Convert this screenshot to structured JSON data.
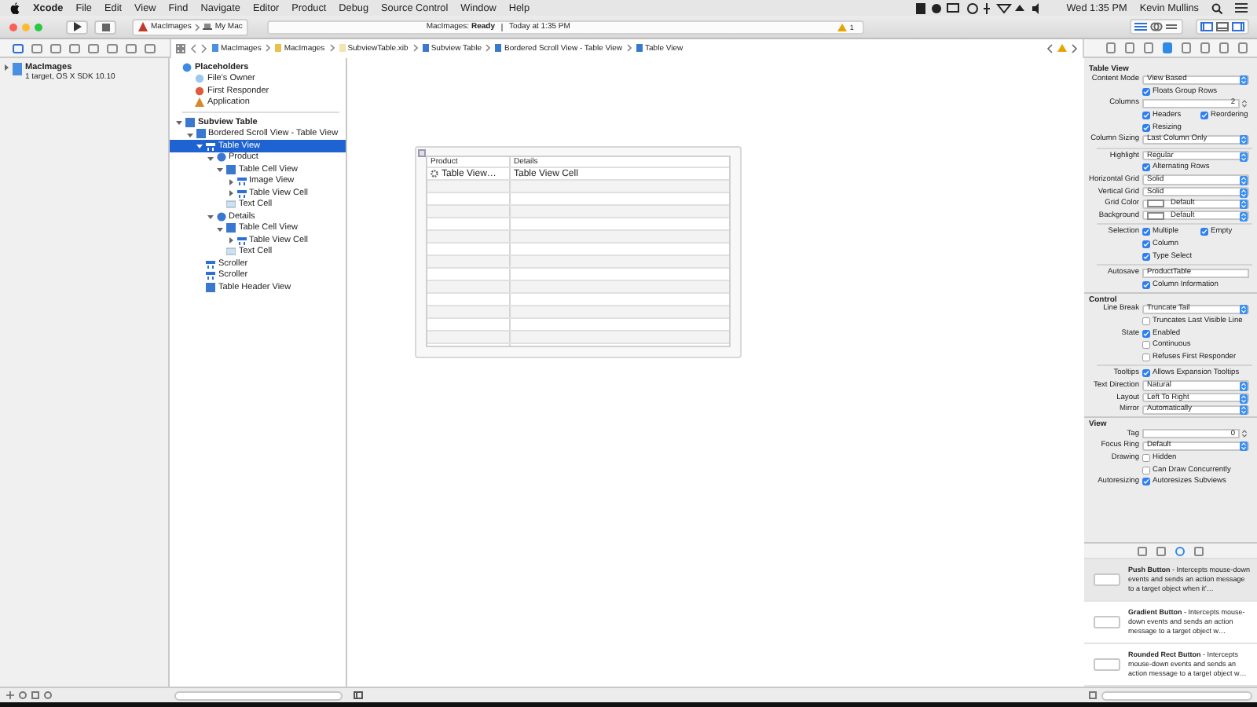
{
  "menu_bar": {
    "app": "Xcode",
    "items": [
      "File",
      "Edit",
      "View",
      "Find",
      "Navigate",
      "Editor",
      "Product",
      "Debug",
      "Source Control",
      "Window",
      "Help"
    ],
    "clock": "Wed 1:35 PM",
    "user": "Kevin Mullins"
  },
  "toolbar": {
    "scheme": "MacImages",
    "destination": "My Mac",
    "activity_project": "MacImages:",
    "activity_status": "Ready",
    "activity_time": "Today at 1:35 PM",
    "warning_count": "1"
  },
  "navigator_tabs": [
    {
      "selected": true
    },
    {
      "selected": false
    },
    {
      "selected": false
    },
    {
      "selected": false
    },
    {
      "selected": false
    },
    {
      "selected": false
    },
    {
      "selected": false
    },
    {
      "selected": false
    }
  ],
  "jump_bar": [
    "MacImages",
    "MacImages",
    "SubviewTable.xib",
    "Subview Table",
    "Bordered Scroll View - Table View",
    "Table View"
  ],
  "navigator": {
    "project": "MacImages",
    "subtitle": "1 target, OS X SDK 10.10",
    "expanded": false
  },
  "outline": {
    "placeholders_title": "Placeholders",
    "placeholders": [
      {
        "kind": "owner",
        "label": "File's Owner"
      },
      {
        "kind": "responder",
        "label": "First Responder"
      },
      {
        "kind": "app",
        "label": "Application"
      }
    ],
    "tree": [
      {
        "kind": "view",
        "label": "Subview Table",
        "expanded": true,
        "selected": false,
        "children": [
          {
            "kind": "view",
            "label": "Bordered Scroll View - Table View",
            "expanded": true,
            "selected": false,
            "children": [
              {
                "kind": "cell",
                "label": "Table View",
                "expanded": true,
                "selected": true,
                "children": [
                  {
                    "kind": "column",
                    "label": "Product",
                    "expanded": true,
                    "selected": false,
                    "children": [
                      {
                        "kind": "view",
                        "label": "Table Cell View",
                        "expanded": true,
                        "selected": false,
                        "children": [
                          {
                            "kind": "cell",
                            "label": "Image View",
                            "expanded": false,
                            "selected": false
                          },
                          {
                            "kind": "cell",
                            "label": "Table View Cell",
                            "expanded": false,
                            "selected": false
                          }
                        ]
                      },
                      {
                        "kind": "text",
                        "label": "Text Cell",
                        "selected": false
                      }
                    ]
                  },
                  {
                    "kind": "column",
                    "label": "Details",
                    "expanded": true,
                    "selected": false,
                    "children": [
                      {
                        "kind": "view",
                        "label": "Table Cell View",
                        "expanded": true,
                        "selected": false,
                        "children": [
                          {
                            "kind": "cell",
                            "label": "Table View Cell",
                            "expanded": false,
                            "selected": false
                          }
                        ]
                      },
                      {
                        "kind": "text",
                        "label": "Text Cell",
                        "selected": false
                      }
                    ]
                  }
                ]
              },
              {
                "kind": "cell",
                "label": "Scroller",
                "selected": false
              },
              {
                "kind": "cell",
                "label": "Scroller",
                "selected": false
              },
              {
                "kind": "view",
                "label": "Table Header View",
                "selected": false
              }
            ]
          }
        ]
      }
    ]
  },
  "canvas_table": {
    "columns": [
      "Product",
      "Details"
    ],
    "first_row": [
      "Table View…",
      "Table View Cell"
    ]
  },
  "inspector_tabs": [
    {
      "selected": false
    },
    {
      "selected": false
    },
    {
      "selected": false
    },
    {
      "selected": true
    },
    {
      "selected": false
    },
    {
      "selected": false
    },
    {
      "selected": false
    },
    {
      "selected": false
    }
  ],
  "inspector": [
    {
      "kind": "section",
      "title": "Table View"
    },
    {
      "kind": "popup",
      "label": "Content Mode",
      "value": "View Based"
    },
    {
      "kind": "checks",
      "checks": [
        {
          "label": "Floats Group Rows",
          "checked": true
        }
      ]
    },
    {
      "kind": "stepper",
      "label": "Columns",
      "value": "2"
    },
    {
      "kind": "checks",
      "checks": [
        {
          "label": "Headers",
          "checked": true
        },
        {
          "label": "Reordering",
          "checked": true
        }
      ]
    },
    {
      "kind": "checks",
      "checks": [
        {
          "label": "Resizing",
          "checked": true
        }
      ]
    },
    {
      "kind": "popup",
      "label": "Column Sizing",
      "value": "Last Column Only"
    },
    {
      "kind": "divider"
    },
    {
      "kind": "popup",
      "label": "Highlight",
      "value": "Regular"
    },
    {
      "kind": "checks",
      "checks": [
        {
          "label": "Alternating Rows",
          "checked": true
        }
      ]
    },
    {
      "kind": "popup",
      "label": "Horizontal Grid",
      "value": "Solid"
    },
    {
      "kind": "popup",
      "label": "Vertical Grid",
      "value": "Solid"
    },
    {
      "kind": "color",
      "label": "Grid Color",
      "value": "Default"
    },
    {
      "kind": "color",
      "label": "Background",
      "value": "Default"
    },
    {
      "kind": "divider"
    },
    {
      "kind": "checks",
      "label": "Selection",
      "checks": [
        {
          "label": "Multiple",
          "checked": true
        },
        {
          "label": "Empty",
          "checked": true
        }
      ]
    },
    {
      "kind": "checks",
      "checks": [
        {
          "label": "Column",
          "checked": true
        }
      ]
    },
    {
      "kind": "checks",
      "checks": [
        {
          "label": "Type Select",
          "checked": true
        }
      ]
    },
    {
      "kind": "divider"
    },
    {
      "kind": "field",
      "label": "Autosave",
      "value": "ProductTable"
    },
    {
      "kind": "checks",
      "checks": [
        {
          "label": "Column Information",
          "checked": true
        }
      ]
    },
    {
      "kind": "section",
      "title": "Control"
    },
    {
      "kind": "popup",
      "label": "Line Break",
      "value": "Truncate Tail"
    },
    {
      "kind": "checks",
      "checks": [
        {
          "label": "Truncates Last Visible Line",
          "checked": false
        }
      ]
    },
    {
      "kind": "checks",
      "label": "State",
      "checks": [
        {
          "label": "Enabled",
          "checked": true
        }
      ]
    },
    {
      "kind": "checks",
      "checks": [
        {
          "label": "Continuous",
          "checked": false
        }
      ]
    },
    {
      "kind": "checks",
      "checks": [
        {
          "label": "Refuses First Responder",
          "checked": false
        }
      ]
    },
    {
      "kind": "divider"
    },
    {
      "kind": "checks",
      "label": "Tooltips",
      "checks": [
        {
          "label": "Allows Expansion Tooltips",
          "checked": true
        }
      ]
    },
    {
      "kind": "popup",
      "label": "Text Direction",
      "value": "Natural"
    },
    {
      "kind": "popup",
      "label": "Layout",
      "value": "Left To Right"
    },
    {
      "kind": "popup",
      "label": "Mirror",
      "value": "Automatically"
    },
    {
      "kind": "section",
      "title": "View"
    },
    {
      "kind": "stepper",
      "label": "Tag",
      "value": "0"
    },
    {
      "kind": "popup",
      "label": "Focus Ring",
      "value": "Default"
    },
    {
      "kind": "checks",
      "label": "Drawing",
      "checks": [
        {
          "label": "Hidden",
          "checked": false
        }
      ]
    },
    {
      "kind": "checks",
      "checks": [
        {
          "label": "Can Draw Concurrently",
          "checked": false
        }
      ]
    },
    {
      "kind": "checks",
      "label": "Autoresizing",
      "checks": [
        {
          "label": "Autoresizes Subviews",
          "checked": true
        }
      ]
    }
  ],
  "library_tabs": [
    {
      "selected": false
    },
    {
      "selected": false
    },
    {
      "selected": true
    },
    {
      "selected": false
    }
  ],
  "library": [
    {
      "text": "**Push Button** - Intercepts mouse-down events and sends an action message to a target object when it'…",
      "selected": true
    },
    {
      "text": "**Gradient Button** - Intercepts mouse-down events and sends an action message to a target object w…",
      "selected": false
    },
    {
      "text": "**Rounded Rect Button** - Intercepts mouse-down events and sends an action message to a target object w…",
      "selected": false
    }
  ]
}
